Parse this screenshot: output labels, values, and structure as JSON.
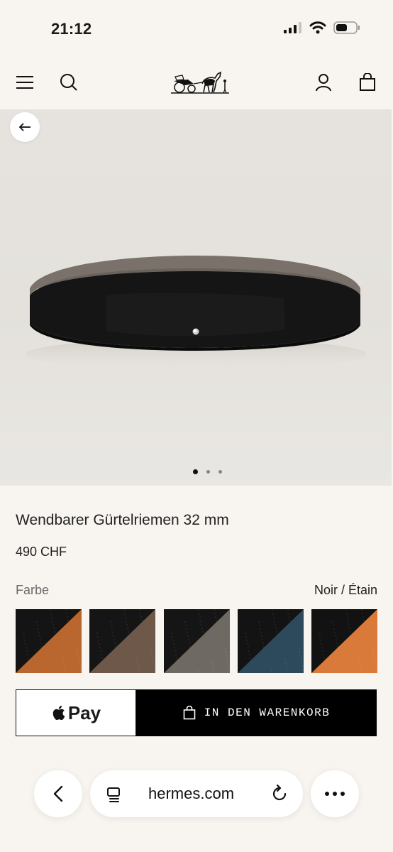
{
  "status_bar": {
    "time": "21:12",
    "icons": [
      "signal-icon",
      "wifi-icon",
      "battery-icon"
    ]
  },
  "header": {
    "icons": [
      "menu-icon",
      "search-icon",
      "brand-logo",
      "account-icon",
      "bag-icon"
    ]
  },
  "gallery": {
    "page_count": 3,
    "active_index": 0
  },
  "product": {
    "title": "Wendbarer Gürtelriemen 32 mm",
    "price": "490 CHF",
    "color_label": "Farbe",
    "color_value": "Noir / Étain"
  },
  "swatches": [
    {
      "name": "noir-gold",
      "color_a": "#141414",
      "color_b": "#b9672e"
    },
    {
      "name": "noir-brown",
      "color_a": "#151515",
      "color_b": "#6d5849"
    },
    {
      "name": "noir-etain",
      "color_a": "#151515",
      "color_b": "#6f6963"
    },
    {
      "name": "noir-blue",
      "color_a": "#131313",
      "color_b": "#2c4a5c"
    },
    {
      "name": "noir-orange",
      "color_a": "#121212",
      "color_b": "#d97a3a"
    }
  ],
  "actions": {
    "applepay_label": "Pay",
    "cart_label": "IN DEN WARENKORB"
  },
  "browser": {
    "url": "hermes.com"
  },
  "colors": {
    "background": "#f8f5f0",
    "button_dark": "#000000"
  }
}
